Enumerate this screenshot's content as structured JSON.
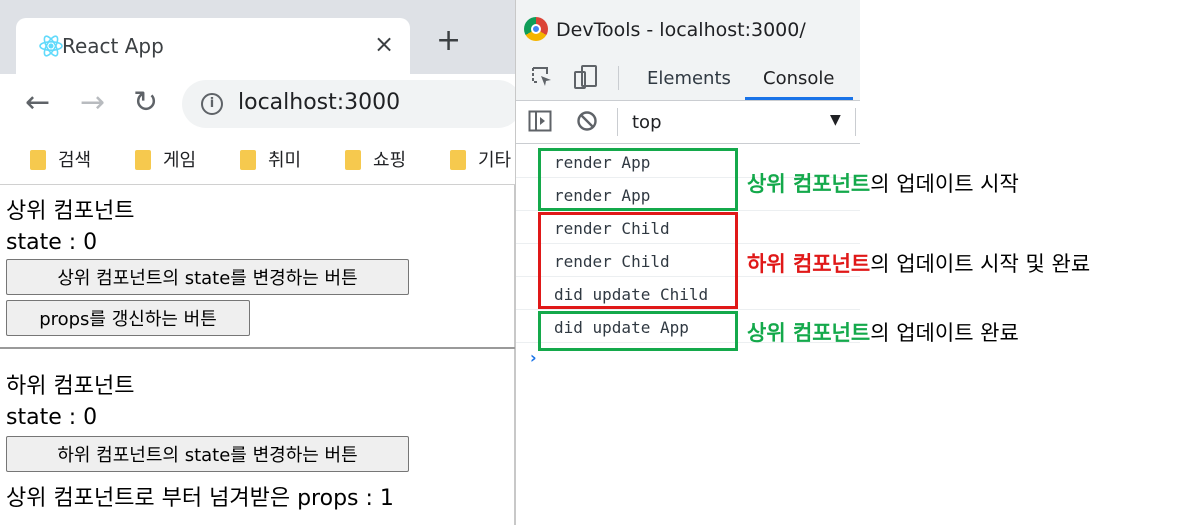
{
  "browser": {
    "tab_title": "React App",
    "tab_close": "×",
    "new_tab": "+",
    "url": "localhost:3000",
    "nav": {
      "back": "←",
      "forward": "→",
      "reload": "↻",
      "info": "i"
    },
    "bookmarks": [
      "검색",
      "게임",
      "취미",
      "쇼핑",
      "기타"
    ]
  },
  "page": {
    "parent": {
      "heading": "상위 컴포넌트",
      "state": "state : 0",
      "change_button": "상위 컴포넌트의 state를 변경하는 버튼",
      "props_button": "props를 갱신하는 버튼"
    },
    "child": {
      "heading": "하위 컴포넌트",
      "state": "state : 0",
      "change_button": "하위 컴포넌트의 state를 변경하는 버튼",
      "props_text": "상위 컴포넌트로 부터 넘겨받은 props : 1"
    }
  },
  "devtools": {
    "title": "DevTools - localhost:3000/",
    "tabs": {
      "elements": "Elements",
      "console": "Console"
    },
    "context": "top",
    "context_arrow": "▼",
    "logs": [
      "render App",
      "render App",
      "render Child",
      "render Child",
      "did update Child",
      "did update App"
    ],
    "prompt": "›"
  },
  "annotations": {
    "first": {
      "highlight": "상위 컴포넌트",
      "rest": "의 업데이트 시작"
    },
    "second": {
      "highlight": "하위 컴포넌트",
      "rest": "의 업데이트 시작 및 완료"
    },
    "third": {
      "highlight": "상위 컴포넌트",
      "rest": "의 업데이트 완료"
    }
  },
  "colors": {
    "green": "#14a94b",
    "red": "#e01818",
    "accent": "#1a73e8"
  }
}
